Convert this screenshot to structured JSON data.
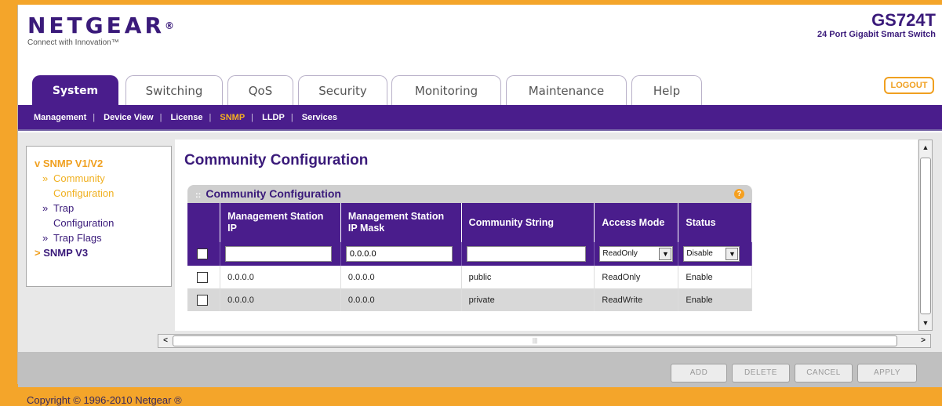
{
  "brand": {
    "name": "NETGEAR",
    "registered": "®",
    "tagline": "Connect with Innovation™"
  },
  "device": {
    "model": "GS724T",
    "description": "24 Port Gigabit Smart Switch"
  },
  "tabs": [
    {
      "label": "System",
      "active": true
    },
    {
      "label": "Switching",
      "active": false
    },
    {
      "label": "QoS",
      "active": false
    },
    {
      "label": "Security",
      "active": false
    },
    {
      "label": "Monitoring",
      "active": false
    },
    {
      "label": "Maintenance",
      "active": false
    },
    {
      "label": "Help",
      "active": false
    }
  ],
  "logout_label": "LOGOUT",
  "subnav": [
    {
      "label": "Management",
      "active": false
    },
    {
      "label": "Device View",
      "active": false
    },
    {
      "label": "License",
      "active": false
    },
    {
      "label": "SNMP",
      "active": true
    },
    {
      "label": "LLDP",
      "active": false
    },
    {
      "label": "Services",
      "active": false
    }
  ],
  "leftnav": {
    "v1v2": {
      "arrow": "v",
      "label": "SNMP V1/V2"
    },
    "items": [
      {
        "line1": "Community",
        "line2": "Configuration",
        "active": true
      },
      {
        "line1": "Trap",
        "line2": "Configuration",
        "active": false
      },
      {
        "line1": "Trap Flags",
        "line2": "",
        "active": false
      }
    ],
    "v3": {
      "arrow": ">",
      "label": "SNMP V3"
    }
  },
  "page_title": "Community Configuration",
  "section_title": "Community Configuration",
  "help_symbol": "?",
  "table": {
    "headers": [
      "",
      "Management Station IP",
      "Management Station IP Mask",
      "Community String",
      "Access Mode",
      "Status"
    ],
    "edit_row": {
      "ip": "",
      "mask": "0.0.0.0",
      "community": "",
      "access_mode": "ReadOnly",
      "status": "Disable"
    },
    "rows": [
      {
        "ip": "0.0.0.0",
        "mask": "0.0.0.0",
        "community": "public",
        "access": "ReadOnly",
        "status": "Enable"
      },
      {
        "ip": "0.0.0.0",
        "mask": "0.0.0.0",
        "community": "private",
        "access": "ReadWrite",
        "status": "Enable"
      }
    ]
  },
  "buttons": {
    "add": "ADD",
    "delete": "DELETE",
    "cancel": "CANCEL",
    "apply": "APPLY"
  },
  "copyright": "Copyright © 1996-2010 Netgear ®",
  "colors": {
    "brand_purple": "#4a1d8c",
    "accent_orange": "#f0a020",
    "outer_bg": "#f4a52a"
  }
}
